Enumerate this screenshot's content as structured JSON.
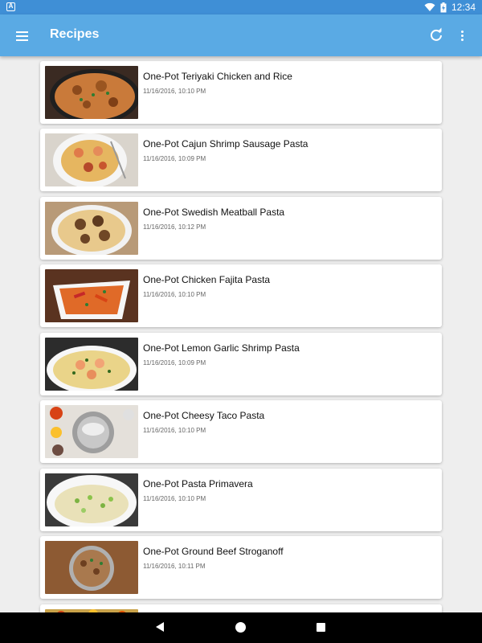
{
  "status_bar": {
    "time": "12:34",
    "notification_icon": "a-notification-icon",
    "wifi_icon": "wifi-icon",
    "battery_icon": "battery-charging-icon"
  },
  "app_bar": {
    "title": "Recipes",
    "menu_icon": "hamburger-menu-icon",
    "refresh_icon": "refresh-icon",
    "more_icon": "more-vert-icon",
    "color": "#5aaae4"
  },
  "recipes": [
    {
      "name": "One-Pot Teriyaki Chicken and Rice",
      "date": "11/16/2016, 10:10 PM"
    },
    {
      "name": "One-Pot Cajun Shrimp Sausage Pasta",
      "date": "11/16/2016, 10:09 PM"
    },
    {
      "name": "One-Pot Swedish Meatball Pasta",
      "date": "11/16/2016, 10:12 PM"
    },
    {
      "name": "One-Pot Chicken Fajita Pasta",
      "date": "11/16/2016, 10:10 PM"
    },
    {
      "name": "One-Pot Lemon Garlic Shrimp Pasta",
      "date": "11/16/2016, 10:09 PM"
    },
    {
      "name": "One-Pot Cheesy Taco Pasta",
      "date": "11/16/2016, 10:10 PM"
    },
    {
      "name": "One-Pot Pasta Primavera",
      "date": "11/16/2016, 10:10 PM"
    },
    {
      "name": "One-Pot Ground Beef Stroganoff",
      "date": "11/16/2016, 10:11 PM"
    },
    {
      "name": "",
      "date": ""
    }
  ],
  "nav_bar": {
    "back_icon": "back-triangle-icon",
    "home_icon": "home-circle-icon",
    "recents_icon": "recents-square-icon"
  }
}
